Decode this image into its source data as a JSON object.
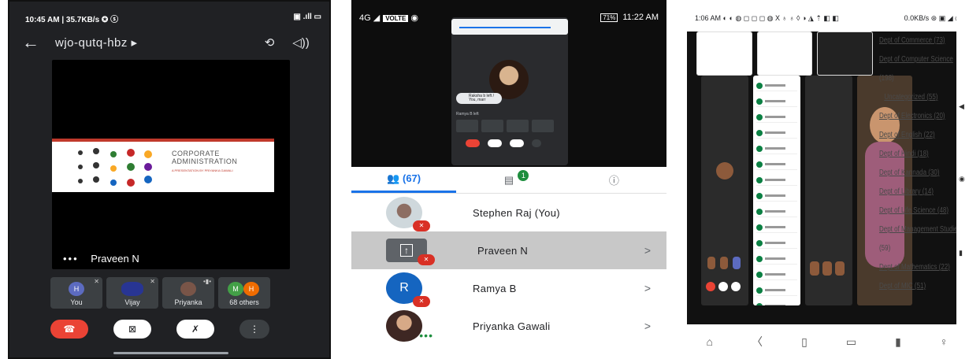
{
  "panel1": {
    "status": {
      "left": "10:45 AM | 35.7KB/s ✪ ⓢ",
      "right": "▣ .ıll ▭"
    },
    "header": {
      "back": "←",
      "meeting_code": "wjo-qutq-hbz ▸",
      "camera_switch": "⟲",
      "speaker": "◁))"
    },
    "slide": {
      "title_line1": "CORPORATE",
      "title_line2": "ADMINISTRATION",
      "subtitle": "A PRESENTATION BY PRIYANKA GAWALI"
    },
    "presenter": {
      "more": "•••",
      "name": "Praveen N"
    },
    "tiles": [
      {
        "label": "You",
        "avatar": "H",
        "color": "#5c6bc0"
      },
      {
        "label": "Vijay",
        "avatar": "",
        "color": "#283593"
      },
      {
        "label": "Priyanka",
        "avatar": "",
        "color": "#795548"
      },
      {
        "label": "68 others",
        "avatar": "M",
        "avatar2": "H",
        "color": "#43a047",
        "color2": "#ef6c00"
      }
    ],
    "controls": {
      "end": "☎",
      "camera": "⊠",
      "mic": "✗",
      "more": "⋮"
    }
  },
  "panel2": {
    "status": {
      "signal": "4G ◢",
      "volte": "VOLTE",
      "icon": "◉",
      "battery": "71%",
      "time": "11:22 AM"
    },
    "mini": {
      "toast": "Raksha b left / You, marr",
      "left_text": "Ramya B left"
    },
    "tabs": [
      {
        "label": "👥 (67)"
      },
      {
        "label": "▤",
        "badge": "1"
      },
      {
        "label": "ⓘ"
      }
    ],
    "participants": [
      {
        "name": "Stephen Raj (You)",
        "kind": "photo",
        "chevron": ""
      },
      {
        "name": "Praveen N",
        "kind": "present",
        "chevron": ">"
      },
      {
        "name": "Ramya B",
        "kind": "letter",
        "letter": "R",
        "chevron": ">"
      },
      {
        "name": "Priyanka Gawali",
        "kind": "photo2",
        "chevron": ">"
      }
    ]
  },
  "panel3": {
    "status": {
      "left": "1:06 AM ◐ ◐ ◍ ◻ ◻ ◻ ◍ X ♁ ♁ ◊ ◑ ◮ ⇡ ◧ ◧",
      "right": "0.0KB/s ⊛ ▣ ◢ ◉"
    },
    "links": [
      {
        "text": "Dept of Commerce (73)",
        "u": true
      },
      {
        "text": "Dept of Computer Science",
        "u": true
      },
      {
        "text": "(198)",
        "u": false
      },
      {
        "text": "Uncategorized (55)",
        "u": true
      },
      {
        "text": "Dept of Electronics (20)",
        "u": true
      },
      {
        "text": "Dept of English (22)",
        "u": true
      },
      {
        "text": "Dept of Hindi (18)",
        "u": true
      },
      {
        "text": "Dept of Kannada (30)",
        "u": true
      },
      {
        "text": "Dept of Library (14)",
        "u": true
      },
      {
        "text": "Dept of Life Science (48)",
        "u": true
      },
      {
        "text": "Dept of Management Studies",
        "u": true
      },
      {
        "text": "(59)",
        "u": false
      },
      {
        "text": "Dept of Mathematics (22)",
        "u": true
      },
      {
        "text": "Dept of MIC (51)",
        "u": true
      }
    ],
    "bottom_nav": [
      "⌂",
      "〈",
      "▯",
      "▭",
      "▮",
      "♀"
    ]
  }
}
